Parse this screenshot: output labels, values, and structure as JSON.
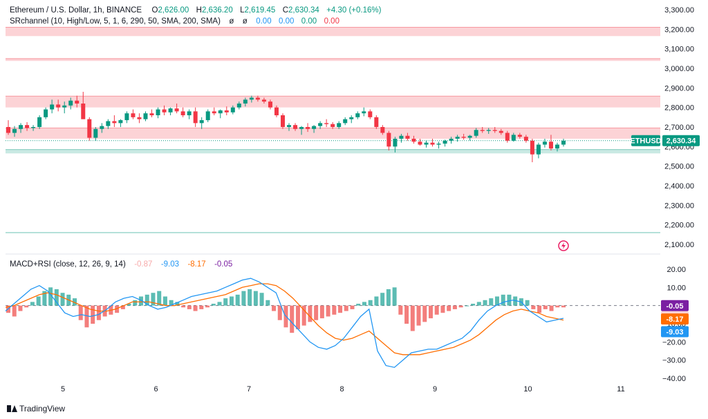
{
  "legend": {
    "symbol": "Ethereum / U.S. Dollar, 1h, BINANCE",
    "o_label": "O",
    "o_value": "2,626.00",
    "h_label": "H",
    "h_value": "2,636.20",
    "l_label": "L",
    "l_value": "2,619.45",
    "c_label": "C",
    "c_value": "2,630.34",
    "change": "+4.30 (+0.16%)",
    "sr_name": "SRchannel (10, High/Low, 5, 1, 6, 290, 50, SMA, 200, SMA)",
    "sr_sym1": "ø",
    "sr_sym2": "ø",
    "sr_vals": [
      "0.00",
      "0.00",
      "0.00",
      "0.00"
    ],
    "macd_name": "MACD+RSI (close, 12, 26, 9, 14)",
    "macd_vals": [
      "-0.87",
      "-9.03",
      "-8.17",
      "-0.05"
    ]
  },
  "price_axis": {
    "ticks": [
      "3,300.00",
      "3,200.00",
      "3,100.00",
      "3,000.00",
      "2,900.00",
      "2,800.00",
      "2,700.00",
      "2,600.00",
      "2,500.00",
      "2,400.00",
      "2,300.00",
      "2,200.00",
      "2,100.00"
    ]
  },
  "macd_axis": {
    "ticks": [
      "20.00",
      "10.00",
      "0.00",
      "−10.00",
      "−20.00",
      "−30.00",
      "−40.00"
    ]
  },
  "time_axis": {
    "ticks": [
      "5",
      "6",
      "7",
      "8",
      "9",
      "10",
      "11"
    ]
  },
  "badges": {
    "ticker": "ETHUSD",
    "price": "2,630.34",
    "m1": "-0.05",
    "m2": "-0.87",
    "m3": "-8.17",
    "m4": "-9.03"
  },
  "branding": {
    "name": "TradingView"
  },
  "colors": {
    "up": "#089981",
    "down": "#f23645",
    "sr_res": "#f23645",
    "sr_sup": "#089981",
    "macd": "#2196f3",
    "signal": "#ff6d00",
    "hist_up": "#26a69a",
    "hist_down": "#ef5350"
  },
  "chart_data": [
    {
      "type": "candlestick",
      "title": "Ethereum / U.S. Dollar, 1h, BINANCE",
      "ylim": [
        2100,
        3300
      ],
      "x_range_days": [
        4.4,
        11.4
      ],
      "sr_zones": [
        {
          "kind": "resistance",
          "low": 3165,
          "high": 3210
        },
        {
          "kind": "resistance",
          "low": 3038,
          "high": 3050
        },
        {
          "kind": "resistance",
          "low": 2800,
          "high": 2858
        },
        {
          "kind": "resistance",
          "low": 2640,
          "high": 2695
        },
        {
          "kind": "support",
          "low": 2565,
          "high": 2585
        },
        {
          "kind": "support_line",
          "value": 2160
        }
      ],
      "ohlc": [
        [
          2700,
          2735,
          2660,
          2670
        ],
        [
          2670,
          2705,
          2650,
          2690
        ],
        [
          2690,
          2720,
          2670,
          2710
        ],
        [
          2710,
          2725,
          2680,
          2695
        ],
        [
          2695,
          2710,
          2680,
          2700
        ],
        [
          2700,
          2760,
          2690,
          2750
        ],
        [
          2750,
          2800,
          2740,
          2790
        ],
        [
          2790,
          2840,
          2770,
          2815
        ],
        [
          2815,
          2840,
          2780,
          2800
        ],
        [
          2800,
          2830,
          2770,
          2810
        ],
        [
          2810,
          2850,
          2790,
          2835
        ],
        [
          2835,
          2860,
          2800,
          2820
        ],
        [
          2820,
          2880,
          2780,
          2740
        ],
        [
          2740,
          2750,
          2630,
          2645
        ],
        [
          2645,
          2700,
          2630,
          2690
        ],
        [
          2690,
          2720,
          2670,
          2705
        ],
        [
          2705,
          2740,
          2690,
          2730
        ],
        [
          2730,
          2760,
          2700,
          2720
        ],
        [
          2720,
          2740,
          2700,
          2735
        ],
        [
          2735,
          2780,
          2720,
          2770
        ],
        [
          2770,
          2790,
          2740,
          2750
        ],
        [
          2750,
          2770,
          2720,
          2740
        ],
        [
          2740,
          2780,
          2730,
          2770
        ],
        [
          2770,
          2790,
          2750,
          2760
        ],
        [
          2760,
          2800,
          2745,
          2790
        ],
        [
          2790,
          2810,
          2760,
          2775
        ],
        [
          2775,
          2800,
          2760,
          2795
        ],
        [
          2795,
          2820,
          2770,
          2780
        ],
        [
          2780,
          2800,
          2750,
          2760
        ],
        [
          2760,
          2790,
          2740,
          2780
        ],
        [
          2780,
          2800,
          2700,
          2720
        ],
        [
          2720,
          2750,
          2690,
          2735
        ],
        [
          2735,
          2790,
          2725,
          2780
        ],
        [
          2780,
          2800,
          2760,
          2770
        ],
        [
          2770,
          2790,
          2745,
          2785
        ],
        [
          2785,
          2805,
          2760,
          2775
        ],
        [
          2775,
          2810,
          2765,
          2800
        ],
        [
          2800,
          2830,
          2790,
          2820
        ],
        [
          2820,
          2850,
          2805,
          2840
        ],
        [
          2840,
          2860,
          2825,
          2850
        ],
        [
          2850,
          2860,
          2830,
          2840
        ],
        [
          2840,
          2850,
          2820,
          2830
        ],
        [
          2830,
          2840,
          2790,
          2800
        ],
        [
          2800,
          2810,
          2750,
          2760
        ],
        [
          2760,
          2770,
          2690,
          2700
        ],
        [
          2700,
          2720,
          2680,
          2710
        ],
        [
          2710,
          2720,
          2680,
          2690
        ],
        [
          2690,
          2705,
          2660,
          2700
        ],
        [
          2700,
          2720,
          2675,
          2690
        ],
        [
          2690,
          2710,
          2670,
          2705
        ],
        [
          2705,
          2730,
          2690,
          2720
        ],
        [
          2720,
          2740,
          2700,
          2715
        ],
        [
          2715,
          2725,
          2690,
          2700
        ],
        [
          2700,
          2730,
          2690,
          2720
        ],
        [
          2720,
          2750,
          2710,
          2740
        ],
        [
          2740,
          2760,
          2720,
          2750
        ],
        [
          2750,
          2780,
          2740,
          2770
        ],
        [
          2770,
          2800,
          2755,
          2780
        ],
        [
          2780,
          2790,
          2740,
          2750
        ],
        [
          2750,
          2760,
          2690,
          2700
        ],
        [
          2700,
          2710,
          2660,
          2670
        ],
        [
          2670,
          2680,
          2580,
          2600
        ],
        [
          2600,
          2650,
          2570,
          2640
        ],
        [
          2640,
          2665,
          2620,
          2655
        ],
        [
          2655,
          2670,
          2630,
          2640
        ],
        [
          2640,
          2655,
          2615,
          2625
        ],
        [
          2625,
          2640,
          2605,
          2610
        ],
        [
          2610,
          2630,
          2595,
          2620
        ],
        [
          2620,
          2640,
          2600,
          2610
        ],
        [
          2610,
          2625,
          2590,
          2615
        ],
        [
          2615,
          2635,
          2600,
          2630
        ],
        [
          2630,
          2650,
          2615,
          2640
        ],
        [
          2640,
          2660,
          2625,
          2650
        ],
        [
          2650,
          2665,
          2635,
          2645
        ],
        [
          2645,
          2660,
          2630,
          2655
        ],
        [
          2655,
          2695,
          2645,
          2685
        ],
        [
          2685,
          2700,
          2670,
          2680
        ],
        [
          2680,
          2695,
          2665,
          2685
        ],
        [
          2685,
          2700,
          2670,
          2680
        ],
        [
          2680,
          2690,
          2660,
          2670
        ],
        [
          2670,
          2680,
          2620,
          2630
        ],
        [
          2630,
          2670,
          2625,
          2660
        ],
        [
          2660,
          2670,
          2640,
          2650
        ],
        [
          2650,
          2660,
          2620,
          2630
        ],
        [
          2630,
          2640,
          2520,
          2560
        ],
        [
          2560,
          2620,
          2540,
          2610
        ],
        [
          2610,
          2640,
          2595,
          2625
        ],
        [
          2625,
          2660,
          2580,
          2590
        ],
        [
          2590,
          2620,
          2575,
          2610
        ],
        [
          2610,
          2640,
          2600,
          2630
        ]
      ]
    },
    {
      "type": "macd_histogram",
      "title": "MACD+RSI (close, 12, 26, 9, 14)",
      "ylim": [
        -40,
        20
      ],
      "histogram": [
        -4,
        -6,
        -3,
        -1,
        2,
        5,
        8,
        10,
        9,
        7,
        6,
        4,
        -8,
        -12,
        -10,
        -8,
        -6,
        -5,
        -4,
        -2,
        1,
        3,
        5,
        6,
        7,
        8,
        5,
        3,
        2,
        -1,
        -2,
        -3,
        -2,
        -1,
        1,
        2,
        4,
        5,
        6,
        8,
        9,
        8,
        7,
        3,
        -3,
        -8,
        -12,
        -15,
        -13,
        -11,
        -9,
        -8,
        -7,
        -6,
        -5,
        -4,
        -3,
        -2,
        1,
        2,
        3,
        5,
        7,
        9,
        10,
        -5,
        -10,
        -14,
        -11,
        -9,
        -7,
        -5,
        -4,
        -3,
        -2,
        -1,
        0,
        1,
        2,
        3,
        4,
        5,
        6,
        6,
        5,
        4,
        3,
        -2,
        -4,
        -2,
        -3,
        -1,
        -1
      ],
      "macd": [
        -3,
        1,
        5,
        9,
        11,
        8,
        2,
        -4,
        -6,
        -5,
        -6,
        -5,
        -2,
        2,
        4,
        5,
        3,
        0,
        -2,
        -1,
        1,
        3,
        5,
        6,
        7,
        8,
        10,
        12,
        14,
        15,
        13,
        10,
        7,
        -5,
        -10,
        -15,
        -20,
        -23,
        -24,
        -22,
        -18,
        -12,
        -6,
        -2,
        -25,
        -33,
        -34,
        -30,
        -26,
        -25,
        -24,
        -24,
        -22,
        -20,
        -18,
        -14,
        -8,
        -3,
        0,
        2,
        3,
        2,
        -3,
        -6,
        -9,
        -8,
        -7
      ],
      "signal": [
        -1,
        0,
        2,
        4,
        6,
        7,
        6,
        4,
        2,
        0,
        -2,
        -3,
        -3,
        -2,
        0,
        2,
        2,
        2,
        1,
        0,
        0,
        1,
        2,
        3,
        4,
        5,
        6,
        8,
        10,
        11,
        12,
        12,
        11,
        8,
        4,
        -1,
        -6,
        -11,
        -15,
        -18,
        -19,
        -18,
        -16,
        -14,
        -18,
        -22,
        -26,
        -27,
        -27,
        -27,
        -26,
        -25,
        -24,
        -23,
        -21,
        -19,
        -16,
        -12,
        -8,
        -5,
        -3,
        -2,
        -3,
        -4,
        -6,
        -7,
        -8
      ],
      "latest": {
        "macd": -9.03,
        "signal": -8.17,
        "histogram": -0.87,
        "rsi_like": -0.05
      }
    }
  ]
}
